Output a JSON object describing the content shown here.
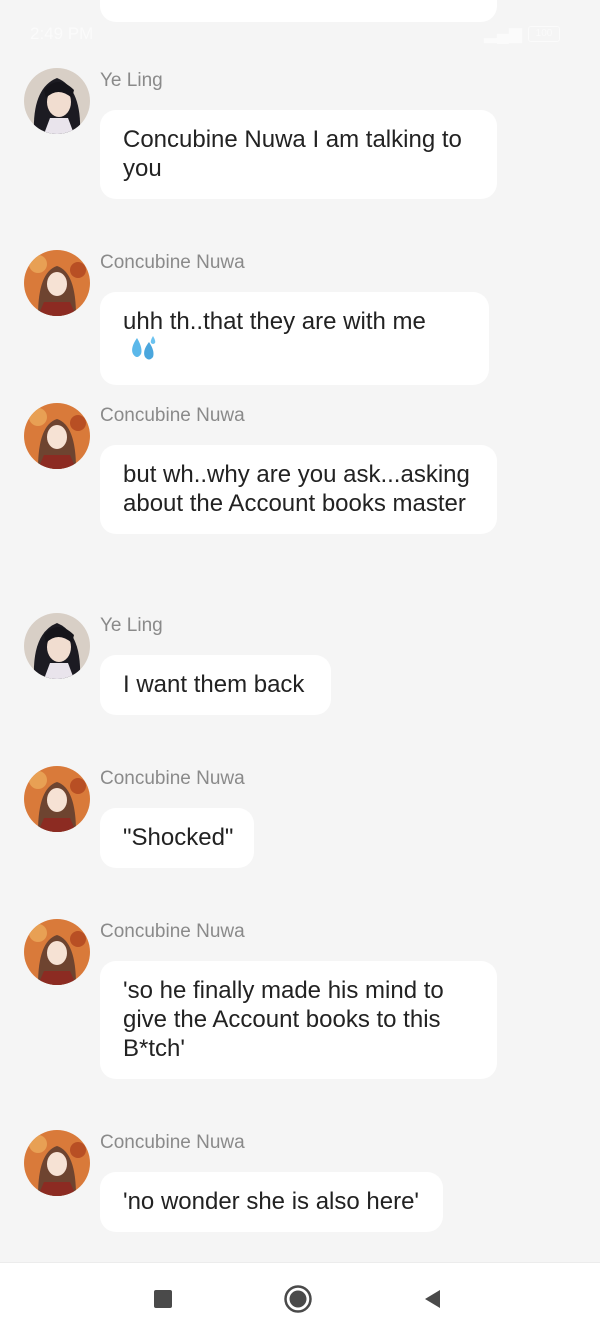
{
  "status_bar": {
    "time": "2:49 PM",
    "battery": "100"
  },
  "colors": {
    "background": "#f5f5f5",
    "bubble": "#ffffff",
    "sender": "#8a8a8a",
    "text": "#222222"
  },
  "messages": [
    {
      "sender": "Ye Ling",
      "avatar": "ye-ling-avatar",
      "text": "Concubine Nuwa I am talking to you"
    },
    {
      "sender": "Concubine Nuwa",
      "avatar": "concubine-nuwa-avatar",
      "text": "uhh th..that they are with me",
      "emoji": "sweat-droplets-icon"
    },
    {
      "sender": "Concubine Nuwa",
      "avatar": "concubine-nuwa-avatar",
      "text": "but wh..why are you ask...asking about the Account books master"
    },
    {
      "sender": "Ye Ling",
      "avatar": "ye-ling-avatar",
      "text": "I want them back"
    },
    {
      "sender": "Concubine Nuwa",
      "avatar": "concubine-nuwa-avatar",
      "text": "\"Shocked\""
    },
    {
      "sender": "Concubine Nuwa",
      "avatar": "concubine-nuwa-avatar",
      "text": "'so he finally made his mind to give the Account books to this B*tch'"
    },
    {
      "sender": "Concubine Nuwa",
      "avatar": "concubine-nuwa-avatar",
      "text": "'no wonder she is also here'"
    }
  ],
  "nav": {
    "recents": "square-icon",
    "home": "circle-icon",
    "back": "triangle-back-icon"
  }
}
